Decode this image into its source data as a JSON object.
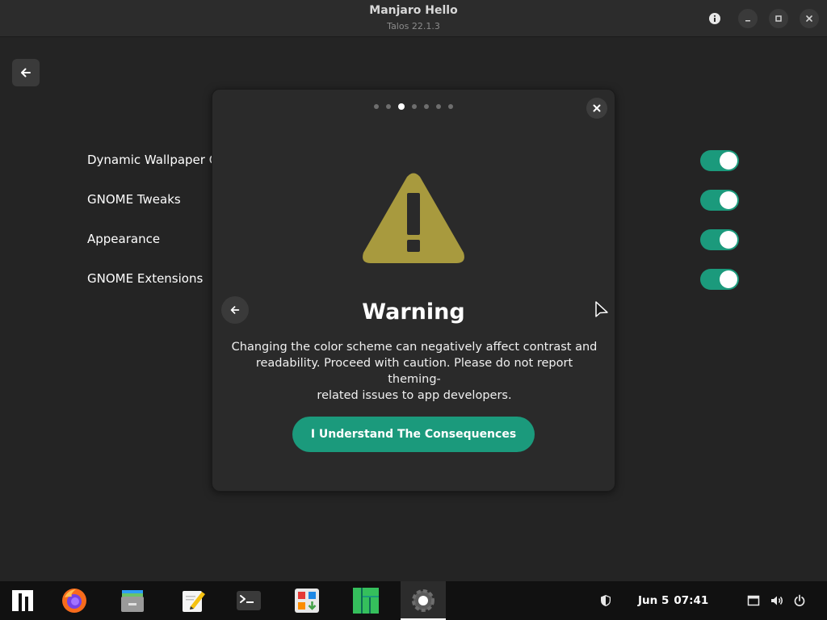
{
  "window": {
    "title": "Manjaro Hello",
    "subtitle": "Talos 22.1.3"
  },
  "settings_list": {
    "items": [
      {
        "label": "Dynamic Wallpaper Cr",
        "enabled": true
      },
      {
        "label": "GNOME Tweaks",
        "enabled": true
      },
      {
        "label": "Appearance",
        "enabled": true
      },
      {
        "label": "GNOME Extensions",
        "enabled": true
      }
    ]
  },
  "dialog": {
    "page_count": 7,
    "current_page": 3,
    "title": "Warning",
    "body_lines": [
      "Changing the color scheme can negatively affect contrast and",
      "readability. Proceed with caution. Please do not report theming-",
      "related issues to app developers."
    ],
    "button_label": "I Understand The Consequences",
    "icon": "warning-triangle-icon"
  },
  "taskbar": {
    "apps": [
      {
        "name": "manjaro-menu-icon"
      },
      {
        "name": "firefox-icon"
      },
      {
        "name": "files-icon"
      },
      {
        "name": "text-editor-icon"
      },
      {
        "name": "terminal-icon"
      },
      {
        "name": "software-icon"
      },
      {
        "name": "manjaro-hello-icon"
      },
      {
        "name": "settings-icon",
        "active": true
      }
    ],
    "clock": {
      "date": "Jun 5",
      "time": "07:41"
    }
  },
  "colors": {
    "accent": "#1b9a7c",
    "warning": "#a89a3e",
    "background": "#242424",
    "dialog": "#2a2a2a"
  }
}
